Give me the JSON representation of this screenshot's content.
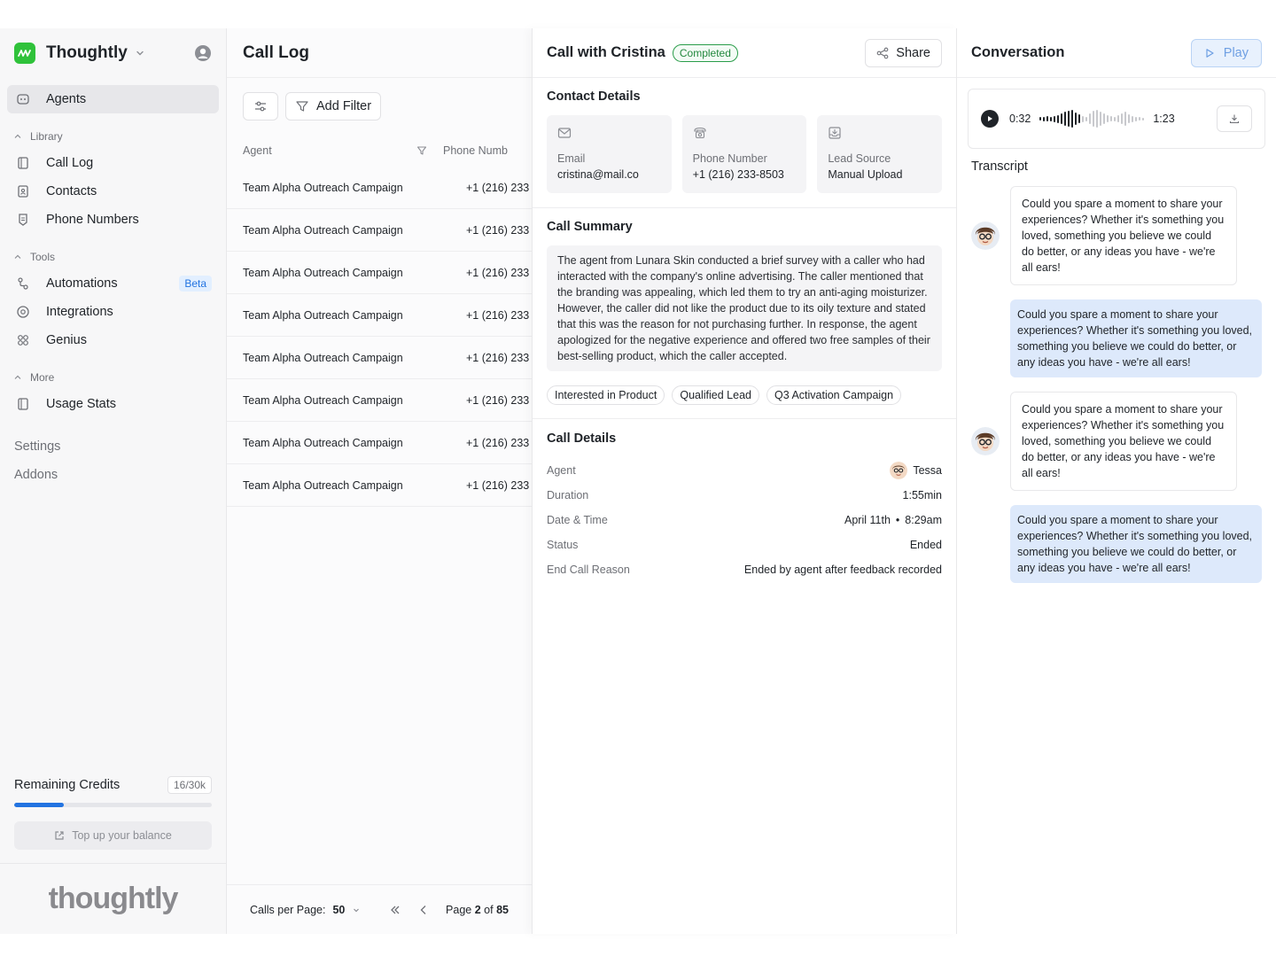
{
  "sidebar": {
    "brand": "Thoughtly",
    "nav_agents": "Agents",
    "section_library": "Library",
    "library_items": [
      "Call Log",
      "Contacts",
      "Phone Numbers"
    ],
    "section_tools": "Tools",
    "tools_items": [
      "Automations",
      "Integrations",
      "Genius"
    ],
    "beta_badge": "Beta",
    "section_more": "More",
    "more_items": [
      "Usage Stats"
    ],
    "settings": "Settings",
    "addons": "Addons",
    "credits_label": "Remaining Credits",
    "credits_count": "16/30k",
    "credits_fraction": 0.25,
    "topup_label": "Top up your balance",
    "footer_wordmark": "thoughtly"
  },
  "call_log": {
    "title": "Call Log",
    "add_filter": "Add Filter",
    "columns": [
      "Agent",
      "Phone Numb"
    ],
    "rows": [
      {
        "agent": "Team Alpha Outreach Campaign",
        "phone": "+1 (216) 233"
      },
      {
        "agent": "Team Alpha Outreach Campaign",
        "phone": "+1 (216) 233"
      },
      {
        "agent": "Team Alpha Outreach Campaign",
        "phone": "+1 (216) 233"
      },
      {
        "agent": "Team Alpha Outreach Campaign",
        "phone": "+1 (216) 233"
      },
      {
        "agent": "Team Alpha Outreach Campaign",
        "phone": "+1 (216) 233"
      },
      {
        "agent": "Team Alpha Outreach Campaign",
        "phone": "+1 (216) 233"
      },
      {
        "agent": "Team Alpha Outreach Campaign",
        "phone": "+1 (216) 233"
      },
      {
        "agent": "Team Alpha Outreach Campaign",
        "phone": "+1 (216) 233"
      }
    ],
    "footer": {
      "calls_per_page_label": "Calls per Page:",
      "calls_per_page_value": "50",
      "page_prefix": "Page",
      "page_current": "2",
      "page_of": "of",
      "page_total": "85"
    }
  },
  "details": {
    "title": "Call with Cristina",
    "status": "Completed",
    "share": "Share",
    "contact_title": "Contact Details",
    "contact": {
      "email_label": "Email",
      "email_value": "cristina@mail.co",
      "phone_label": "Phone Number",
      "phone_value": "+1 (216) 233-8503",
      "source_label": "Lead Source",
      "source_value": "Manual Upload"
    },
    "summary_title": "Call Summary",
    "summary_text": "The agent from Lunara Skin conducted a brief survey with a caller who had interacted with the company's online advertising. The caller mentioned that the branding was appealing, which led them to try an anti-aging moisturizer. However, the caller did not like the product due to its oily texture and stated that this was the reason for not purchasing further. In response, the agent apologized for the negative experience and offered two free samples of their best-selling product, which the caller accepted.",
    "tags": [
      "Interested in Product",
      "Qualified Lead",
      "Q3 Activation Campaign"
    ],
    "call_details_title": "Call Details",
    "rows": {
      "agent_label": "Agent",
      "agent_value": "Tessa",
      "duration_label": "Duration",
      "duration_value": "1:55min",
      "datetime_label": "Date & Time",
      "date_value": "April 11th",
      "time_value": "8:29am",
      "status_label": "Status",
      "status_value": "Ended",
      "reason_label": "End Call Reason",
      "reason_value": "Ended by agent after feedback recorded"
    }
  },
  "conversation": {
    "title": "Conversation",
    "play": "Play",
    "audio": {
      "current": "0:32",
      "total": "1:23",
      "progress": 0.4
    },
    "transcript_title": "Transcript",
    "messages": [
      {
        "role": "agent",
        "text": "Could you spare a moment to share your experiences? Whether it's something you loved, something you believe we could do better, or any ideas you have - we're all ears!"
      },
      {
        "role": "user",
        "text": "Could you spare a moment to share your experiences? Whether it's something you loved, something you believe we could do better, or any ideas you have - we're all ears!"
      },
      {
        "role": "agent",
        "text": "Could you spare a moment to share your experiences? Whether it's something you loved, something you believe we could do better, or any ideas you have - we're all ears!"
      },
      {
        "role": "user",
        "text": "Could you spare a moment to share your experiences? Whether it's something you loved, something you believe we could do better, or any ideas you have - we're all ears!"
      }
    ]
  },
  "colors": {
    "accent": "#2374e1",
    "brand_green": "#2fc23a",
    "status_green": "#23883e",
    "user_bubble": "#dde9fb"
  }
}
